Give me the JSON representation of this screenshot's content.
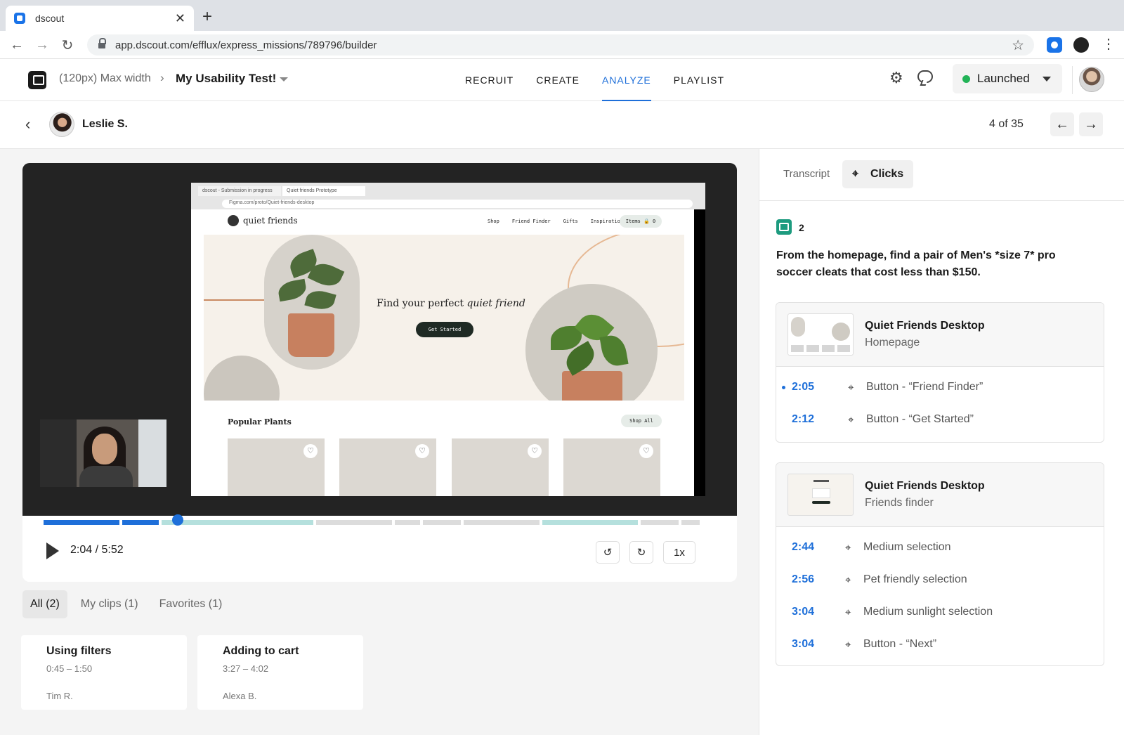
{
  "browser": {
    "tab_title": "dscout",
    "url": "app.dscout.com/efflux/express_missions/789796/builder"
  },
  "header": {
    "breadcrumb_parent": "(120px) Max width",
    "breadcrumb_current": "My Usability Test!",
    "nav": [
      "RECRUIT",
      "CREATE",
      "ANALYZE",
      "PLAYLIST"
    ],
    "active_nav": "ANALYZE",
    "status_label": "Launched",
    "status_color": "#22b357"
  },
  "participant": {
    "name": "Leslie S.",
    "position": "4 of 35"
  },
  "player": {
    "time": "2:04 / 5:52",
    "speed": "1x",
    "progress_fraction": 0.2
  },
  "prototype": {
    "tab1": "dscout - Submission in progress",
    "tab2": "Quiet friends Prototype",
    "url": "Figma.com/proto/Quiet-friends-desktop",
    "brand": "quiet friends",
    "links": [
      "Shop",
      "Friend Finder",
      "Gifts",
      "Inspiration"
    ],
    "items": "Items 🔒 0",
    "headline_pre": "Find your perfect ",
    "headline_em": "quiet friend",
    "cta": "Get Started",
    "section_title": "Popular Plants",
    "shop_all": "Shop All"
  },
  "clips": {
    "tabs": [
      "All (2)",
      "My clips (1)",
      "Favorites (1)"
    ],
    "cards": [
      {
        "title": "Using filters",
        "range": "0:45 – 1:50",
        "author": "Tim R."
      },
      {
        "title": "Adding to cart",
        "range": "3:27 – 4:02",
        "author": "Alexa B."
      }
    ]
  },
  "panel": {
    "tabs": [
      "Transcript",
      "Clicks"
    ],
    "active_tab": "Clicks",
    "task_number": "2",
    "task_text": "From the homepage, find a pair of Men's *size 7* pro soccer cleats that cost less than $150.",
    "screens": [
      {
        "title": "Quiet Friends Desktop",
        "subtitle": "Homepage",
        "clicks": [
          {
            "time": "2:05",
            "label": "Button - “Friend Finder”",
            "current": true
          },
          {
            "time": "2:12",
            "label": "Button - “Get Started”"
          }
        ]
      },
      {
        "title": "Quiet Friends Desktop",
        "subtitle": "Friends finder",
        "clicks": [
          {
            "time": "2:44",
            "label": "Medium selection"
          },
          {
            "time": "2:56",
            "label": "Pet friendly selection"
          },
          {
            "time": "3:04",
            "label": "Medium sunlight selection"
          },
          {
            "time": "3:04",
            "label": "Button - “Next”"
          }
        ]
      }
    ]
  },
  "colors": {
    "accent": "#1e6fd9",
    "progress_played": "#1e6fd9",
    "progress_clip": "#b5e0dd",
    "progress_rest": "#dcdcdc"
  }
}
